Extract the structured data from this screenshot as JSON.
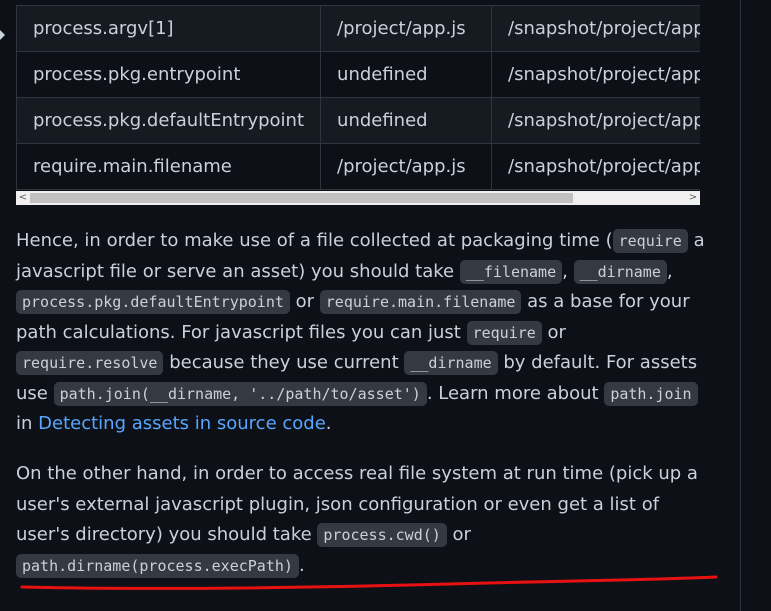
{
  "table": {
    "rows": [
      [
        "process.argv[1]",
        "/project/app.js",
        "/snapshot/project/app"
      ],
      [
        "process.pkg.entrypoint",
        "undefined",
        "/snapshot/project/app"
      ],
      [
        "process.pkg.defaultEntrypoint",
        "undefined",
        "/snapshot/project/app"
      ],
      [
        "require.main.filename",
        "/project/app.js",
        "/snapshot/project/app"
      ]
    ]
  },
  "scrollbar": {
    "left_arrow": "<",
    "right_arrow": ">"
  },
  "para1": {
    "t1": "Hence, in order to make use of a file collected at packaging time (",
    "c1": "require",
    "t2": " a javascript file or serve an asset) you should take ",
    "c2": "__filename",
    "t3": ", ",
    "c3": "__dirname",
    "t4": ", ",
    "c4": "process.pkg.defaultEntrypoint",
    "t5": " or ",
    "c5": "require.main.filename",
    "t6": " as a base for your path calculations. For javascript files you can just ",
    "c6": "require",
    "t7": " or ",
    "c7": "require.resolve",
    "t8": " because they use current ",
    "c8": "__dirname",
    "t9": " by default. For assets use ",
    "c9": "path.join(__dirname, '../path/to/asset')",
    "t10": ". Learn more about ",
    "c10": "path.join",
    "t11": " in ",
    "link": "Detecting assets in source code",
    "t12": "."
  },
  "para2": {
    "t1": "On the other hand, in order to access real file system at run time (pick up a user's external javascript plugin, json configuration or even get a list of user's directory) you should take ",
    "c1": "process.cwd()",
    "t2": " or ",
    "c2": "path.dirname(process.execPath)",
    "t3": "."
  },
  "colors": {
    "annotation": "#e81010",
    "link": "#58a6ff",
    "code_bg": "#343942"
  }
}
